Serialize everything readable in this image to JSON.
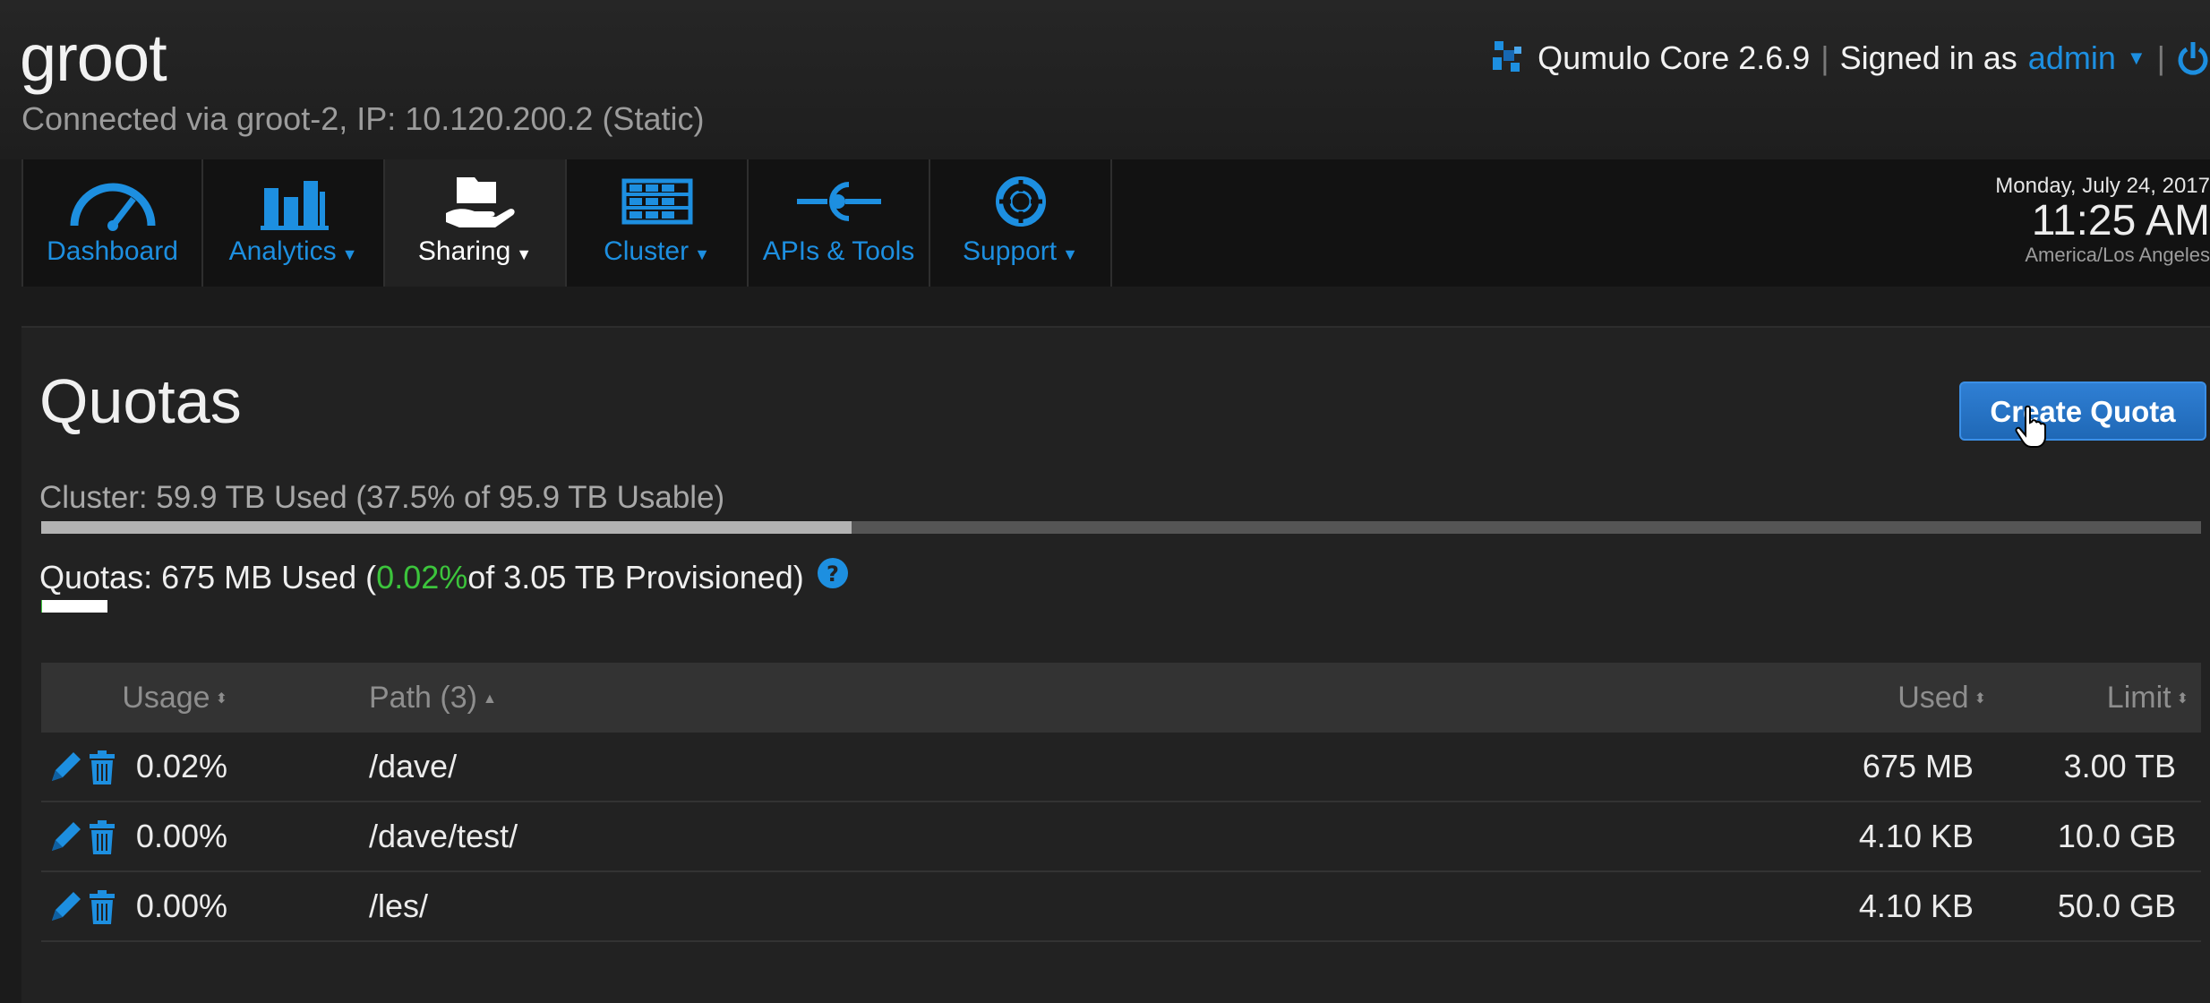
{
  "header": {
    "cluster_name": "groot",
    "connection": "Connected via groot-2, IP: 10.120.200.2 (Static)",
    "product": "Qumulo Core 2.6.9",
    "separator": "|",
    "signed_in_prefix": "Signed in as",
    "user": "admin",
    "brand_color": "#1d8fe0"
  },
  "nav": {
    "tabs": [
      {
        "label": "Dashboard",
        "icon": "gauge-icon",
        "dropdown": false,
        "active": false
      },
      {
        "label": "Analytics",
        "icon": "bar-chart-icon",
        "dropdown": true,
        "active": false
      },
      {
        "label": "Sharing",
        "icon": "sharing-hand-icon",
        "dropdown": true,
        "active": true
      },
      {
        "label": "Cluster",
        "icon": "server-icon",
        "dropdown": true,
        "active": false
      },
      {
        "label": "APIs & Tools",
        "icon": "api-connector-icon",
        "dropdown": false,
        "active": false
      },
      {
        "label": "Support",
        "icon": "lifebuoy-icon",
        "dropdown": true,
        "active": false
      }
    ]
  },
  "clock": {
    "date": "Monday, July 24, 2017",
    "time": "11:25 AM",
    "timezone": "America/Los Angeles"
  },
  "page": {
    "title": "Quotas",
    "create_button": "Create Quota",
    "cluster_usage": {
      "text": "Cluster: 59.9 TB Used (37.5% of 95.9 TB Usable)",
      "percent": 37.5
    },
    "quota_usage": {
      "prefix": "Quotas: 675 MB Used (",
      "percent_text": "0.02%",
      "suffix": " of 3.05 TB Provisioned)",
      "percent": 0.02
    }
  },
  "table": {
    "headers": {
      "usage": "Usage",
      "path": "Path (3)",
      "used": "Used",
      "limit": "Limit"
    },
    "rows": [
      {
        "usage": "0.02%",
        "path": "/dave/",
        "used": "675 MB",
        "limit": "3.00 TB"
      },
      {
        "usage": "0.00%",
        "path": "/dave/test/",
        "used": "4.10 KB",
        "limit": "10.0 GB"
      },
      {
        "usage": "0.00%",
        "path": "/les/",
        "used": "4.10 KB",
        "limit": "50.0 GB"
      }
    ]
  }
}
